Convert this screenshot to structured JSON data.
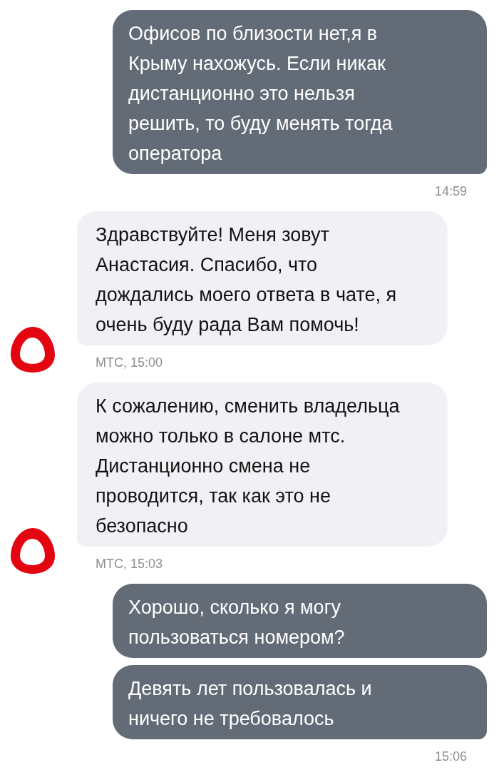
{
  "messages": [
    {
      "kind": "outgoing",
      "text": "Офисов по близости нет,я в Крыму нахожусь. Если никак дистанционно это нельзя решить, то буду менять тогда оператора",
      "time": "14:59"
    },
    {
      "kind": "incoming",
      "text": "Здравствуйте! Меня зовут Анастасия. Спасибо, что дождались моего ответа в чате, я очень буду рада Вам помочь!",
      "meta": "МТС, 15:00"
    },
    {
      "kind": "incoming",
      "text": "К сожалению, сменить владельца можно только в салоне мтс. Дистанционно смена не проводится, так как это не безопасно",
      "meta": "МТС, 15:03"
    },
    {
      "kind": "outgoing",
      "text": "Хорошо, сколько я могу пользоваться номером?"
    },
    {
      "kind": "outgoing",
      "text": "Девять лет пользовалась и ничего не требовалось",
      "time": "15:06"
    }
  ]
}
